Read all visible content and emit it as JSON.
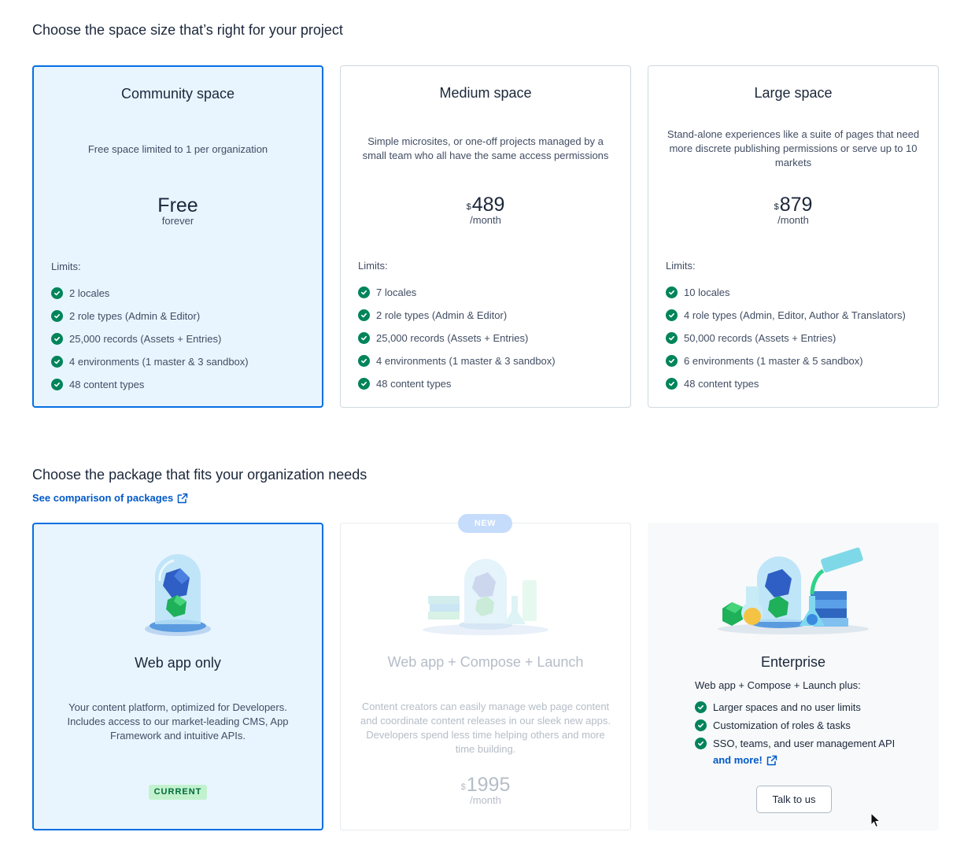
{
  "space_section": {
    "title": "Choose the space size that’s right for your project",
    "plans": [
      {
        "name": "Community space",
        "description": "Free space limited to 1 per organization",
        "price_text": "Free",
        "period": "forever",
        "limits_label": "Limits:",
        "limits": [
          "2 locales",
          "2 role types (Admin & Editor)",
          "25,000 records (Assets + Entries)",
          "4 environments (1 master & 3 sandbox)",
          "48 content types"
        ],
        "selected": true
      },
      {
        "name": "Medium space",
        "description": "Simple microsites, or one-off projects managed by a small team who all have the same access permissions",
        "currency": "$",
        "price": "489",
        "period": "/month",
        "limits_label": "Limits:",
        "limits": [
          "7 locales",
          "2 role types (Admin & Editor)",
          "25,000 records (Assets + Entries)",
          "4 environments (1 master & 3 sandbox)",
          "48 content types"
        ],
        "selected": false
      },
      {
        "name": "Large space",
        "description": "Stand-alone experiences like a suite of pages that need more discrete publishing permissions or serve up to 10 markets",
        "currency": "$",
        "price": "879",
        "period": "/month",
        "limits_label": "Limits:",
        "limits": [
          "10 locales",
          "4 role types (Admin, Editor, Author & Translators)",
          "50,000 records (Assets + Entries)",
          "6 environments (1 master & 5 sandbox)",
          "48 content types"
        ],
        "selected": false
      }
    ]
  },
  "package_section": {
    "title": "Choose the package that fits your organization needs",
    "compare_link": "See comparison of packages",
    "packages": [
      {
        "name": "Web app only",
        "description": "Your content platform, optimized for Developers. Includes access to our market-leading CMS, App Framework and intuitive APIs.",
        "badge": "CURRENT",
        "selected": true
      },
      {
        "name": "Web app + Compose + Launch",
        "description": "Content creators can easily manage web page content and coordinate content releases in our sleek new apps. Developers spend less time helping others and more time building.",
        "badge": "NEW",
        "currency": "$",
        "price": "1995",
        "period": "/month",
        "disabled": true
      },
      {
        "name": "Enterprise",
        "intro": "Web app + Compose + Launch plus:",
        "features": [
          "Larger spaces and no user limits",
          "Customization of roles & tasks",
          "SSO, teams, and user management API"
        ],
        "more_link": "and more!",
        "cta": "Talk to us"
      }
    ]
  },
  "colors": {
    "accent": "#036fe3",
    "selected_bg": "#e8f5ff",
    "check_green": "#00845a",
    "link": "#0059c8"
  }
}
